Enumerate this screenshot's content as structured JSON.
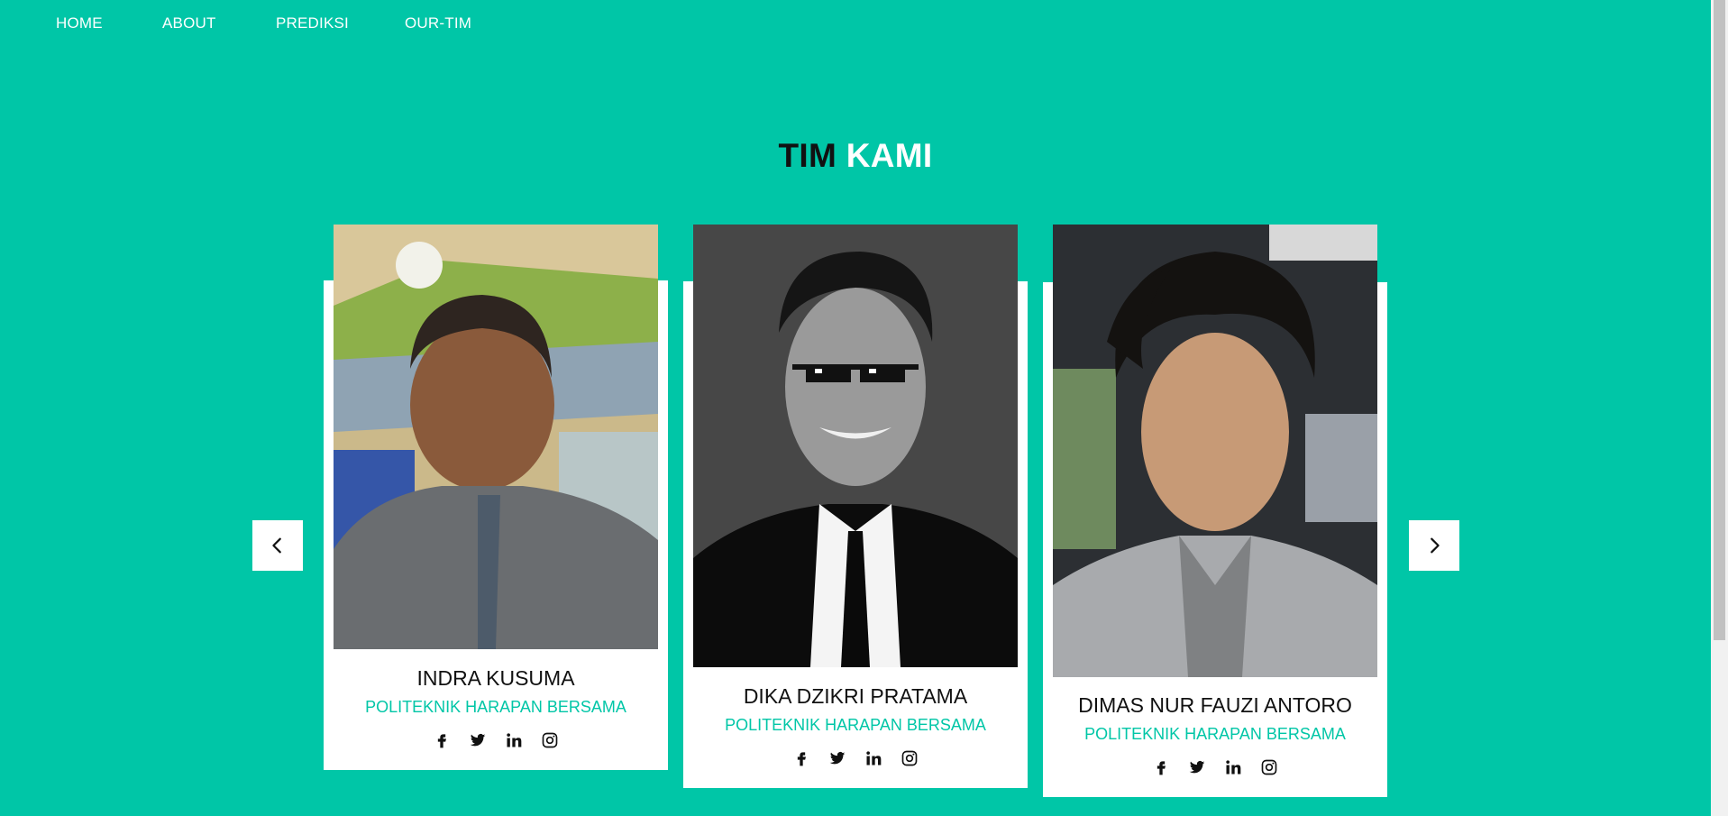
{
  "nav": {
    "items": [
      {
        "label": "HOME"
      },
      {
        "label": "ABOUT"
      },
      {
        "label": "PREDIKSI"
      },
      {
        "label": "OUR-TIM"
      }
    ]
  },
  "section": {
    "title_dark": "TIM",
    "title_light": "KAMI"
  },
  "members": [
    {
      "name": "INDRA KUSUMA",
      "school": "POLITEKNIK HARAPAN BERSAMA"
    },
    {
      "name": "DIKA DZIKRI PRATAMA",
      "school": "POLITEKNIK HARAPAN BERSAMA"
    },
    {
      "name": "DIMAS NUR FAUZI ANTORO",
      "school": "POLITEKNIK HARAPAN BERSAMA"
    }
  ],
  "social_icons": [
    "facebook-icon",
    "twitter-icon",
    "linkedin-icon",
    "instagram-icon"
  ],
  "colors": {
    "background": "#00c6a7",
    "accent": "#00c6a7",
    "text_dark": "#111111",
    "card": "#ffffff"
  },
  "carousel": {
    "prev_icon": "chevron-left-icon",
    "next_icon": "chevron-right-icon"
  }
}
